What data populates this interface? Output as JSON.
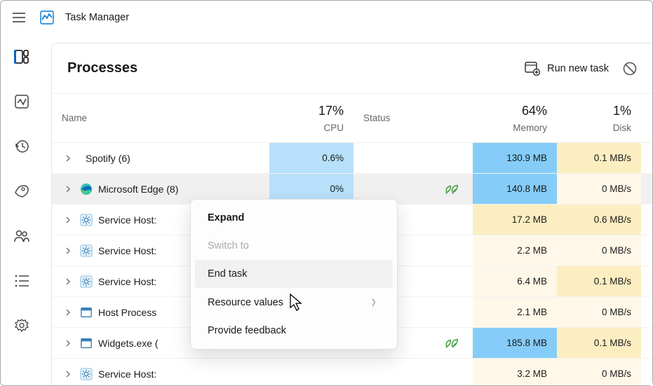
{
  "app": {
    "title": "Task Manager"
  },
  "rail": {
    "items": [
      {
        "name": "processes",
        "selected": true
      },
      {
        "name": "performance"
      },
      {
        "name": "app-history"
      },
      {
        "name": "startup"
      },
      {
        "name": "users"
      },
      {
        "name": "details"
      },
      {
        "name": "services"
      }
    ]
  },
  "header": {
    "title": "Processes",
    "run_new_task": "Run new task"
  },
  "columns": {
    "name": "Name",
    "cpu_pct": "17%",
    "cpu_lbl": "CPU",
    "status": "Status",
    "mem_pct": "64%",
    "mem_lbl": "Memory",
    "disk_pct": "1%",
    "disk_lbl": "Disk"
  },
  "rows": [
    {
      "name": "Spotify (6)",
      "icon": "blank",
      "cpu": "0.6%",
      "eco": false,
      "mem": "130.9 MB",
      "disk": "0.1 MB/s",
      "cpu_heat": "heat-2",
      "mem_heat": "heat-3",
      "disk_heat": "heat-d1",
      "sel": false
    },
    {
      "name": "Microsoft Edge (8)",
      "icon": "edge",
      "cpu": "0%",
      "eco": true,
      "mem": "140.8 MB",
      "disk": "0 MB/s",
      "cpu_heat": "heat-2",
      "mem_heat": "heat-3",
      "disk_heat": "heat-d0",
      "sel": true
    },
    {
      "name": "Service Host:",
      "icon": "gear",
      "cpu": "",
      "eco": false,
      "mem": "17.2 MB",
      "disk": "0.6 MB/s",
      "cpu_heat": "",
      "mem_heat": "heat-1",
      "disk_heat": "heat-d1",
      "sel": false
    },
    {
      "name": "Service Host:",
      "icon": "gear",
      "cpu": "",
      "eco": false,
      "mem": "2.2 MB",
      "disk": "0 MB/s",
      "cpu_heat": "",
      "mem_heat": "heat-0",
      "disk_heat": "heat-d0",
      "sel": false
    },
    {
      "name": "Service Host:",
      "icon": "gear",
      "cpu": "",
      "eco": false,
      "mem": "6.4 MB",
      "disk": "0.1 MB/s",
      "cpu_heat": "",
      "mem_heat": "heat-0",
      "disk_heat": "heat-d1",
      "sel": false
    },
    {
      "name": "Host Process",
      "icon": "window",
      "cpu": "",
      "eco": false,
      "mem": "2.1 MB",
      "disk": "0 MB/s",
      "cpu_heat": "",
      "mem_heat": "heat-0",
      "disk_heat": "heat-d0",
      "sel": false
    },
    {
      "name": "Widgets.exe (",
      "icon": "window",
      "cpu": "",
      "eco": true,
      "mem": "185.8 MB",
      "disk": "0.1 MB/s",
      "cpu_heat": "",
      "mem_heat": "heat-3",
      "disk_heat": "heat-d1",
      "sel": false
    },
    {
      "name": "Service Host:",
      "icon": "gear",
      "cpu": "",
      "eco": false,
      "mem": "3.2 MB",
      "disk": "0 MB/s",
      "cpu_heat": "",
      "mem_heat": "heat-0",
      "disk_heat": "heat-d0",
      "sel": false
    }
  ],
  "menu": {
    "expand": "Expand",
    "switch_to": "Switch to",
    "end_task": "End task",
    "resource_values": "Resource values",
    "provide_feedback": "Provide feedback"
  }
}
